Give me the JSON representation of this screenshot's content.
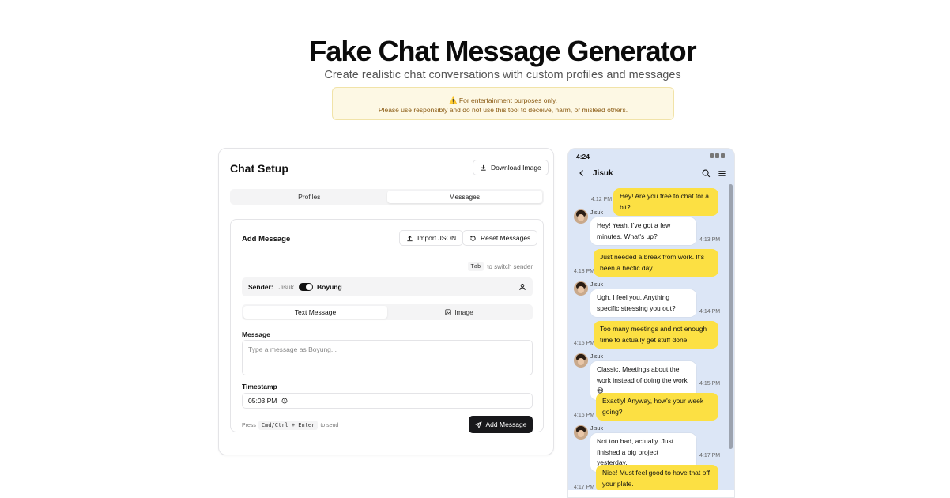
{
  "header": {
    "title": "Fake Chat Message Generator",
    "subtitle": "Create realistic chat conversations with custom profiles and messages",
    "warning_line1": "⚠️ For entertainment purposes only.",
    "warning_line2": "Please use responsibly and do not use this tool to deceive, harm, or mislead others."
  },
  "setup": {
    "title": "Chat Setup",
    "download_label": "Download Image",
    "tabs": [
      "Profiles",
      "Messages"
    ],
    "active_tab": "Messages",
    "add_message": {
      "title": "Add Message",
      "import_label": "Import JSON",
      "reset_label": "Reset Messages",
      "tab_key": "Tab",
      "tab_hint": "to switch sender",
      "sender_label": "Sender:",
      "sender_a": "Jisuk",
      "sender_b": "Boyung",
      "type_tabs": [
        "Text Message",
        "Image"
      ],
      "message_label": "Message",
      "message_placeholder": "Type a message as Boyung...",
      "timestamp_label": "Timestamp",
      "timestamp_value": "05:03 PM",
      "send_hint_prefix": "Press",
      "send_hint_key": "Cmd/Ctrl + Enter",
      "send_hint_suffix": "to send",
      "add_label": "Add Message"
    }
  },
  "phone": {
    "time": "4:24",
    "contact": "Jisuk",
    "accent": "#fce043",
    "background": "#dce6f6",
    "messages": [
      {
        "from": "me",
        "text": "Hey! Are you free to chat for a bit?",
        "time": "4:12 PM"
      },
      {
        "from": "them",
        "name": "Jisuk",
        "text": "Hey! Yeah, I've got a few minutes. What's up?",
        "time": "4:13 PM"
      },
      {
        "from": "me",
        "text": "Just needed a break from work. It's been a hectic day.",
        "time": "4:13 PM"
      },
      {
        "from": "them",
        "name": "Jisuk",
        "text": "Ugh, I feel you. Anything specific stressing you out?",
        "time": "4:14 PM"
      },
      {
        "from": "me",
        "text": "Too many meetings and not enough time to actually get stuff done.",
        "time": "4:15 PM"
      },
      {
        "from": "them",
        "name": "Jisuk",
        "text": "Classic. Meetings about the work instead of doing the work 😅",
        "time": "4:15 PM"
      },
      {
        "from": "me",
        "text": "Exactly! Anyway, how's your week going?",
        "time": "4:16 PM"
      },
      {
        "from": "them",
        "name": "Jisuk",
        "text": "Not too bad, actually. Just finished a big project yesterday.",
        "time": "4:17 PM"
      },
      {
        "from": "me",
        "text": "Nice! Must feel good to have that off your plate.",
        "time": "4:17 PM"
      }
    ]
  }
}
